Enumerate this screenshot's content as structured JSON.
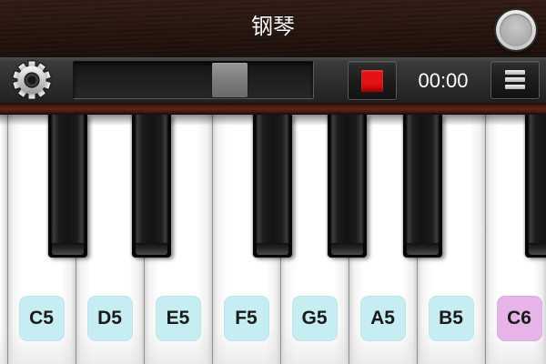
{
  "app": {
    "title": "钢琴"
  },
  "overlay": {
    "floating_button_icon": "circle-button-icon"
  },
  "toolbar": {
    "settings_icon": "gear-icon",
    "keyboard_slider": {
      "position": 0.68
    },
    "record_button_icon": "stop-square-icon",
    "record_color": "#e41212",
    "time": "00:00",
    "menu_icon": "hamburger-menu-icon"
  },
  "keyboard": {
    "white_keys": [
      {
        "label": "C5",
        "badge_color": "#c6eef2"
      },
      {
        "label": "D5",
        "badge_color": "#c6eef2"
      },
      {
        "label": "E5",
        "badge_color": "#c6eef2"
      },
      {
        "label": "F5",
        "badge_color": "#c6eef2"
      },
      {
        "label": "G5",
        "badge_color": "#c6eef2"
      },
      {
        "label": "A5",
        "badge_color": "#c6eef2"
      },
      {
        "label": "B5",
        "badge_color": "#c6eef2"
      },
      {
        "label": "C6",
        "badge_color": "#e6b4e8"
      }
    ]
  }
}
